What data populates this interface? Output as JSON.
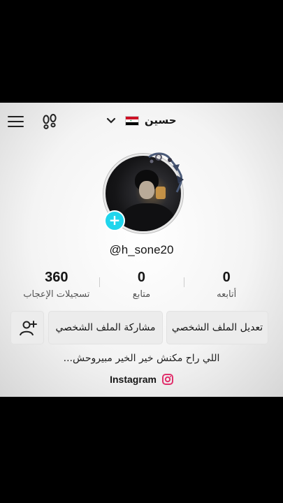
{
  "header": {
    "display_name": "حسين",
    "flag_country": "Iraq",
    "menu_icon": "hamburger-icon",
    "steps_icon": "footprints-icon",
    "chevron_icon": "chevron-down-icon"
  },
  "profile": {
    "handle": "@h_sone20",
    "add_icon": "plus-icon",
    "add_symbol": "+"
  },
  "stats": [
    {
      "value": "0",
      "label": "أتابعه"
    },
    {
      "value": "0",
      "label": "متابع"
    },
    {
      "value": "360",
      "label": "تسجيلات الإعجاب"
    }
  ],
  "actions": {
    "edit_profile": "تعديل الملف الشخصي",
    "share_profile": "مشاركة الملف الشخصي",
    "add_friends_icon": "add-user-icon"
  },
  "bio": "اللي راح مكنش خير الخير مبيروحش...",
  "link": {
    "label": "Instagram",
    "icon": "instagram-icon"
  },
  "colors": {
    "accent_cyan": "#20d5ec",
    "text": "#161616",
    "button_bg": "#ececec",
    "instagram": "#e1306c"
  }
}
